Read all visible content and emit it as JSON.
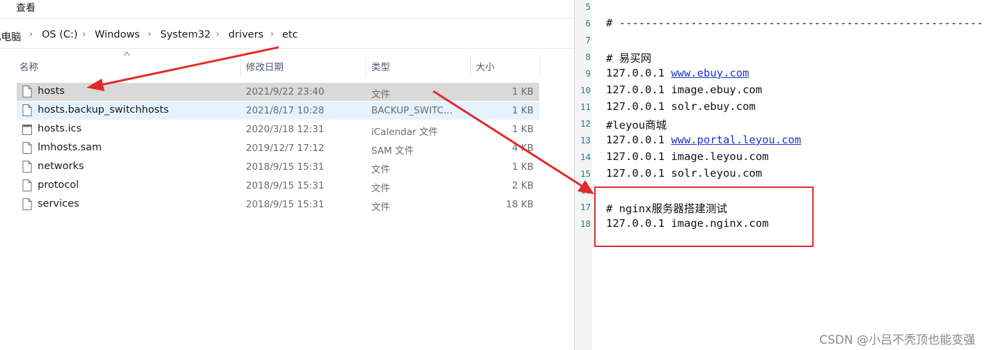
{
  "menu": {
    "view_label": "查看"
  },
  "breadcrumb": {
    "items": [
      "此电脑",
      "OS (C:)",
      "Windows",
      "System32",
      "drivers",
      "etc"
    ]
  },
  "columns": {
    "name": "名称",
    "date": "修改日期",
    "type": "类型",
    "size": "大小"
  },
  "files": [
    {
      "name": "hosts",
      "date": "2021/9/22 23:40",
      "type": "文件",
      "size": "1 KB",
      "icon": "file-icon",
      "state": "selected"
    },
    {
      "name": "hosts.backup_switchhosts",
      "date": "2021/8/17 10:28",
      "type": "BACKUP_SWITC...",
      "size": "1 KB",
      "icon": "file-icon",
      "state": "hover"
    },
    {
      "name": "hosts.ics",
      "date": "2020/3/18 12:31",
      "type": "iCalendar 文件",
      "size": "1 KB",
      "icon": "calendar-file-icon",
      "state": ""
    },
    {
      "name": "lmhosts.sam",
      "date": "2019/12/7 17:12",
      "type": "SAM 文件",
      "size": "4 KB",
      "icon": "file-icon",
      "state": ""
    },
    {
      "name": "networks",
      "date": "2018/9/15 15:31",
      "type": "文件",
      "size": "1 KB",
      "icon": "file-icon",
      "state": ""
    },
    {
      "name": "protocol",
      "date": "2018/9/15 15:31",
      "type": "文件",
      "size": "2 KB",
      "icon": "file-icon",
      "state": ""
    },
    {
      "name": "services",
      "date": "2018/9/15 15:31",
      "type": "文件",
      "size": "18 KB",
      "icon": "file-icon",
      "state": ""
    }
  ],
  "editor": {
    "lines": [
      {
        "num": "5",
        "text": "",
        "link": ""
      },
      {
        "num": "6",
        "text": "# --------------------------------------------------------",
        "link": ""
      },
      {
        "num": "7",
        "text": "",
        "link": ""
      },
      {
        "num": "8",
        "text": "# 易买网",
        "link": ""
      },
      {
        "num": "9",
        "text": "127.0.0.1 ",
        "link": "www.ebuy.com"
      },
      {
        "num": "10",
        "text": "127.0.0.1 image.ebuy.com",
        "link": ""
      },
      {
        "num": "11",
        "text": "127.0.0.1 solr.ebuy.com",
        "link": ""
      },
      {
        "num": "12",
        "text": "#leyou商城",
        "link": ""
      },
      {
        "num": "13",
        "text": "127.0.0.1 ",
        "link": "www.portal.leyou.com"
      },
      {
        "num": "14",
        "text": "127.0.0.1 image.leyou.com",
        "link": ""
      },
      {
        "num": "15",
        "text": "127.0.0.1 solr.leyou.com",
        "link": ""
      },
      {
        "num": "16",
        "text": "",
        "link": ""
      },
      {
        "num": "17",
        "text": "# nginx服务器搭建测试",
        "link": ""
      },
      {
        "num": "18",
        "text": "127.0.0.1 image.nginx.com",
        "link": ""
      }
    ]
  },
  "watermark": "CSDN @小吕不秃顶也能变强",
  "colors": {
    "annotation": "#e02b2b",
    "link": "#1a33cc",
    "selected_row": "#d9d9d9",
    "hover_row": "#e5f3ff"
  }
}
